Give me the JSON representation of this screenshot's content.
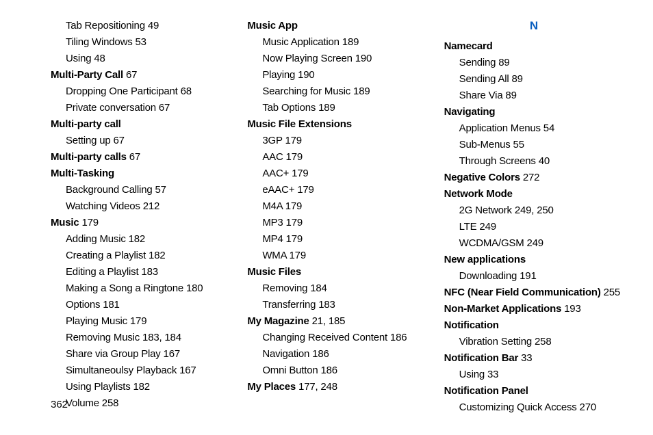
{
  "page_number": "362",
  "columns": [
    {
      "heading": null,
      "entries": [
        {
          "level": 1,
          "bold": false,
          "text": "Tab Repositioning",
          "pages": "49"
        },
        {
          "level": 1,
          "bold": false,
          "text": "Tiling Windows",
          "pages": "53"
        },
        {
          "level": 1,
          "bold": false,
          "text": "Using",
          "pages": "48"
        },
        {
          "level": 0,
          "bold": true,
          "text": "Multi-Party Call",
          "pages": "67"
        },
        {
          "level": 1,
          "bold": false,
          "text": "Dropping One Participant",
          "pages": "68"
        },
        {
          "level": 1,
          "bold": false,
          "text": "Private conversation",
          "pages": "67"
        },
        {
          "level": 0,
          "bold": true,
          "text": "Multi-party call",
          "pages": ""
        },
        {
          "level": 1,
          "bold": false,
          "text": "Setting up",
          "pages": "67"
        },
        {
          "level": 0,
          "bold": true,
          "text": "Multi-party calls",
          "pages": "67"
        },
        {
          "level": 0,
          "bold": true,
          "text": "Multi-Tasking",
          "pages": ""
        },
        {
          "level": 1,
          "bold": false,
          "text": "Background Calling",
          "pages": "57"
        },
        {
          "level": 1,
          "bold": false,
          "text": "Watching Videos",
          "pages": "212"
        },
        {
          "level": 0,
          "bold": true,
          "text": "Music",
          "pages": "179"
        },
        {
          "level": 1,
          "bold": false,
          "text": "Adding Music",
          "pages": "182"
        },
        {
          "level": 1,
          "bold": false,
          "text": "Creating a Playlist",
          "pages": "182"
        },
        {
          "level": 1,
          "bold": false,
          "text": "Editing a Playlist",
          "pages": "183"
        },
        {
          "level": 1,
          "bold": false,
          "text": "Making a Song a Ringtone",
          "pages": "180"
        },
        {
          "level": 1,
          "bold": false,
          "text": "Options",
          "pages": "181"
        },
        {
          "level": 1,
          "bold": false,
          "text": "Playing Music",
          "pages": "179"
        },
        {
          "level": 1,
          "bold": false,
          "text": "Removing Music",
          "pages": "183, 184"
        },
        {
          "level": 1,
          "bold": false,
          "text": "Share via Group Play",
          "pages": "167"
        },
        {
          "level": 1,
          "bold": false,
          "text": "Simultaneoulsy Playback",
          "pages": "167"
        },
        {
          "level": 1,
          "bold": false,
          "text": "Using Playlists",
          "pages": "182"
        },
        {
          "level": 1,
          "bold": false,
          "text": "Volume",
          "pages": "258"
        }
      ]
    },
    {
      "heading": null,
      "entries": [
        {
          "level": 0,
          "bold": true,
          "text": "Music App",
          "pages": ""
        },
        {
          "level": 1,
          "bold": false,
          "text": "Music Application",
          "pages": "189"
        },
        {
          "level": 1,
          "bold": false,
          "text": "Now Playing Screen",
          "pages": "190"
        },
        {
          "level": 1,
          "bold": false,
          "text": "Playing",
          "pages": "190"
        },
        {
          "level": 1,
          "bold": false,
          "text": "Searching for Music",
          "pages": "189"
        },
        {
          "level": 1,
          "bold": false,
          "text": "Tab Options",
          "pages": "189"
        },
        {
          "level": 0,
          "bold": true,
          "text": "Music File Extensions",
          "pages": ""
        },
        {
          "level": 1,
          "bold": false,
          "text": "3GP",
          "pages": "179"
        },
        {
          "level": 1,
          "bold": false,
          "text": "AAC",
          "pages": "179"
        },
        {
          "level": 1,
          "bold": false,
          "text": "AAC+",
          "pages": "179"
        },
        {
          "level": 1,
          "bold": false,
          "text": "eAAC+",
          "pages": "179"
        },
        {
          "level": 1,
          "bold": false,
          "text": "M4A",
          "pages": "179"
        },
        {
          "level": 1,
          "bold": false,
          "text": "MP3",
          "pages": "179"
        },
        {
          "level": 1,
          "bold": false,
          "text": "MP4",
          "pages": "179"
        },
        {
          "level": 1,
          "bold": false,
          "text": "WMA",
          "pages": "179"
        },
        {
          "level": 0,
          "bold": true,
          "text": "Music Files",
          "pages": ""
        },
        {
          "level": 1,
          "bold": false,
          "text": "Removing",
          "pages": "184"
        },
        {
          "level": 1,
          "bold": false,
          "text": "Transferring",
          "pages": "183"
        },
        {
          "level": 0,
          "bold": true,
          "text": "My Magazine",
          "pages": "21, 185"
        },
        {
          "level": 1,
          "bold": false,
          "text": "Changing Received Content",
          "pages": "186"
        },
        {
          "level": 1,
          "bold": false,
          "text": "Navigation",
          "pages": "186"
        },
        {
          "level": 1,
          "bold": false,
          "text": "Omni Button",
          "pages": "186"
        },
        {
          "level": 0,
          "bold": true,
          "text": "My Places",
          "pages": "177, 248"
        }
      ]
    },
    {
      "heading": "N",
      "entries": [
        {
          "level": 0,
          "bold": true,
          "text": "Namecard",
          "pages": ""
        },
        {
          "level": 1,
          "bold": false,
          "text": "Sending",
          "pages": "89"
        },
        {
          "level": 1,
          "bold": false,
          "text": "Sending All",
          "pages": "89"
        },
        {
          "level": 1,
          "bold": false,
          "text": "Share Via",
          "pages": "89"
        },
        {
          "level": 0,
          "bold": true,
          "text": "Navigating",
          "pages": ""
        },
        {
          "level": 1,
          "bold": false,
          "text": "Application Menus",
          "pages": "54"
        },
        {
          "level": 1,
          "bold": false,
          "text": "Sub-Menus",
          "pages": "55"
        },
        {
          "level": 1,
          "bold": false,
          "text": "Through Screens",
          "pages": "40"
        },
        {
          "level": 0,
          "bold": true,
          "text": "Negative Colors",
          "pages": "272"
        },
        {
          "level": 0,
          "bold": true,
          "text": "Network Mode",
          "pages": ""
        },
        {
          "level": 1,
          "bold": false,
          "text": "2G Network",
          "pages": "249, 250"
        },
        {
          "level": 1,
          "bold": false,
          "text": "LTE",
          "pages": "249"
        },
        {
          "level": 1,
          "bold": false,
          "text": "WCDMA/GSM",
          "pages": "249"
        },
        {
          "level": 0,
          "bold": true,
          "text": "New applications",
          "pages": ""
        },
        {
          "level": 1,
          "bold": false,
          "text": "Downloading",
          "pages": "191"
        },
        {
          "level": 0,
          "bold": true,
          "text": "NFC (Near Field Communication)",
          "pages": "255"
        },
        {
          "level": 0,
          "bold": true,
          "text": "Non-Market Applications",
          "pages": "193"
        },
        {
          "level": 0,
          "bold": true,
          "text": "Notification",
          "pages": ""
        },
        {
          "level": 1,
          "bold": false,
          "text": "Vibration Setting",
          "pages": "258"
        },
        {
          "level": 0,
          "bold": true,
          "text": "Notification Bar",
          "pages": "33"
        },
        {
          "level": 1,
          "bold": false,
          "text": "Using",
          "pages": "33"
        },
        {
          "level": 0,
          "bold": true,
          "text": "Notification Panel",
          "pages": ""
        },
        {
          "level": 1,
          "bold": false,
          "text": "Customizing Quick Access",
          "pages": "270"
        }
      ]
    }
  ]
}
